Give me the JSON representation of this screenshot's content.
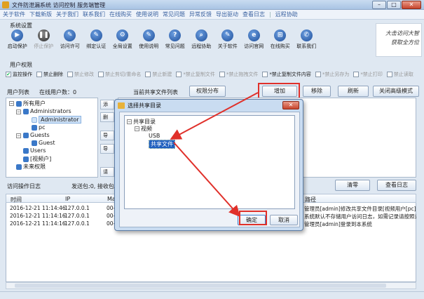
{
  "window": {
    "title": "文件防泄漏系统 访问控制 服务端管理",
    "buttons": {
      "minimize": "–",
      "maximize": "□",
      "close": "✕"
    }
  },
  "menu": [
    "关于软件",
    "下载新版",
    "关于我们",
    "联系我们",
    "在线购买",
    "使用说明",
    "常见问题",
    "异常反馈",
    "导出驱动",
    "查看日志",
    "|",
    "远程协助"
  ],
  "system_settings": {
    "label": "系统设置",
    "tools": [
      {
        "label": "启动保护",
        "icon": "start-icon",
        "glyph": "▶",
        "disabled": false
      },
      {
        "label": "停止保护",
        "icon": "pause-icon",
        "glyph": "❚❚",
        "disabled": true
      },
      {
        "label": "访问许可",
        "icon": "permission-icon",
        "glyph": "✎",
        "disabled": false
      },
      {
        "label": "绑定认证",
        "icon": "auth-icon",
        "glyph": "✎",
        "disabled": false
      },
      {
        "label": "全局设置",
        "icon": "settings-icon",
        "glyph": "⚙",
        "disabled": false
      },
      {
        "label": "使用说明",
        "icon": "manual-icon",
        "glyph": "✎",
        "disabled": false
      },
      {
        "label": "常见问题",
        "icon": "faq-icon",
        "glyph": "?",
        "disabled": false
      },
      {
        "label": "远程协助",
        "icon": "remote-icon",
        "glyph": "⌕",
        "disabled": false
      },
      {
        "label": "关于软件",
        "icon": "about-icon",
        "glyph": "✎",
        "disabled": false
      },
      {
        "label": "访问官网",
        "icon": "website-icon",
        "glyph": "e",
        "disabled": false
      },
      {
        "label": "在线购买",
        "icon": "cart-icon",
        "glyph": "⊞",
        "disabled": false
      },
      {
        "label": "联系我们",
        "icon": "contact-icon",
        "glyph": "✆",
        "disabled": false
      }
    ],
    "slogan_line1": "大击访问大智",
    "slogan_line2": "获取全方位"
  },
  "user_permissions": {
    "label": "用户权限",
    "items": [
      {
        "label": "监控操作",
        "checked": true,
        "enabled": true
      },
      {
        "label": "禁止删除",
        "checked": false,
        "enabled": true
      },
      {
        "label": "禁止修改",
        "checked": false,
        "enabled": false
      },
      {
        "label": "禁止剪切/重命名",
        "checked": false,
        "enabled": false
      },
      {
        "label": "禁止新建",
        "checked": false,
        "enabled": false
      },
      {
        "label": "*禁止复制文件",
        "checked": false,
        "enabled": false
      },
      {
        "label": "*禁止拖拽文件",
        "checked": false,
        "enabled": false
      },
      {
        "label": "*禁止复制文件内容",
        "checked": false,
        "enabled": true
      },
      {
        "label": "*禁止另存为",
        "checked": false,
        "enabled": false
      },
      {
        "label": "*禁止打印",
        "checked": false,
        "enabled": false
      },
      {
        "label": "禁止读取",
        "checked": false,
        "enabled": false
      }
    ]
  },
  "user_list": {
    "label": "用户列表",
    "online_label": "在线用户数：0",
    "tree": {
      "root": "所有用户",
      "groups": [
        {
          "name": "Administrators",
          "children": [
            "Administrator",
            "pc"
          ]
        },
        {
          "name": "Guests",
          "children": [
            "Guest"
          ]
        },
        {
          "name": "Users",
          "children": []
        },
        {
          "name": "[视频户]",
          "children": []
        }
      ],
      "extra": "未来权限"
    },
    "side_buttons": [
      "添",
      "删",
      "导",
      "导",
      "请"
    ]
  },
  "shared_files": {
    "label": "当前共享文件列表",
    "permission_button": "权限分布",
    "add_button": "增加",
    "remove_button": "移除",
    "refresh_button": "刷新",
    "close_button": "关闭高级模式"
  },
  "log": {
    "label": "访问操作日志",
    "stats": "发送包:0, 接收包:0",
    "clear_button": "清零",
    "view_button": "查看日志",
    "columns": [
      "时间",
      "IP",
      "Ma",
      "路径"
    ],
    "rows": [
      {
        "time": "2016-12-21 11:14:46",
        "ip": "127.0.0.1",
        "mac": "00-",
        "path": "管理员[admin]修改共享文件目录[视频用户[pc]访问权"
      },
      {
        "time": "2016-12-21 11:14:16",
        "ip": "127.0.0.1",
        "mac": "00-",
        "path": "系统默认不存储用户访问日志，如需记录请按照说明设"
      },
      {
        "time": "2016-12-21 11:14:16",
        "ip": "127.0.0.1",
        "mac": "00-",
        "path": "管理员[admin]登录到本系统"
      }
    ]
  },
  "dialog": {
    "title": "选择共享目录",
    "close": "✕",
    "tree": {
      "root": "共享目录",
      "folder": "视频",
      "items": [
        "USB",
        "共享文件"
      ]
    },
    "ok_button": "确定",
    "cancel_button": "取消"
  },
  "colors": {
    "accent": "#3a62a0",
    "highlight": "#e0302a",
    "selection": "#1f5fbf"
  }
}
